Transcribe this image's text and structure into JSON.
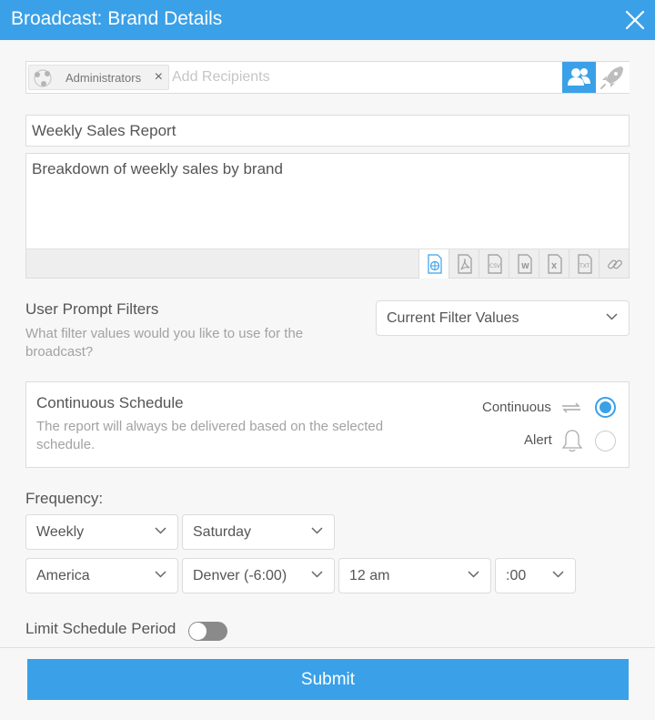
{
  "window": {
    "title": "Broadcast: Brand Details"
  },
  "recipients": {
    "chip_label": "Administrators",
    "chip_remove": "×",
    "placeholder": "Add Recipients"
  },
  "report": {
    "title": "Weekly Sales Report",
    "description": "Breakdown of weekly sales by brand",
    "formats": [
      "web",
      "pdf",
      "csv",
      "word",
      "excel",
      "txt",
      "link"
    ],
    "format_labels": {
      "csv": "CSV",
      "txt": "TXT",
      "word": "W",
      "excel": "X"
    },
    "selected_format": "web"
  },
  "filters": {
    "title": "User Prompt Filters",
    "subtitle_line1": "What filter values would you like to use for the",
    "subtitle_line2": "broadcast?",
    "selected": "Current Filter Values"
  },
  "schedule": {
    "title": "Continuous Schedule",
    "subtitle_line1": "The report will always be delivered based on the selected",
    "subtitle_line2": "schedule.",
    "option_continuous": "Continuous",
    "option_alert": "Alert",
    "selected": "Continuous"
  },
  "frequency": {
    "label": "Frequency:",
    "interval": "Weekly",
    "day": "Saturday",
    "region": "America",
    "timezone": "Denver (-6:00)",
    "hour": "12 am",
    "minute": ":00"
  },
  "limit": {
    "label": "Limit Schedule Period",
    "enabled": false
  },
  "footer": {
    "submit_label": "Submit"
  },
  "colors": {
    "accent": "#3aa0e8",
    "background": "#f7f7f7",
    "toggle_off": "#8a8a8a"
  }
}
